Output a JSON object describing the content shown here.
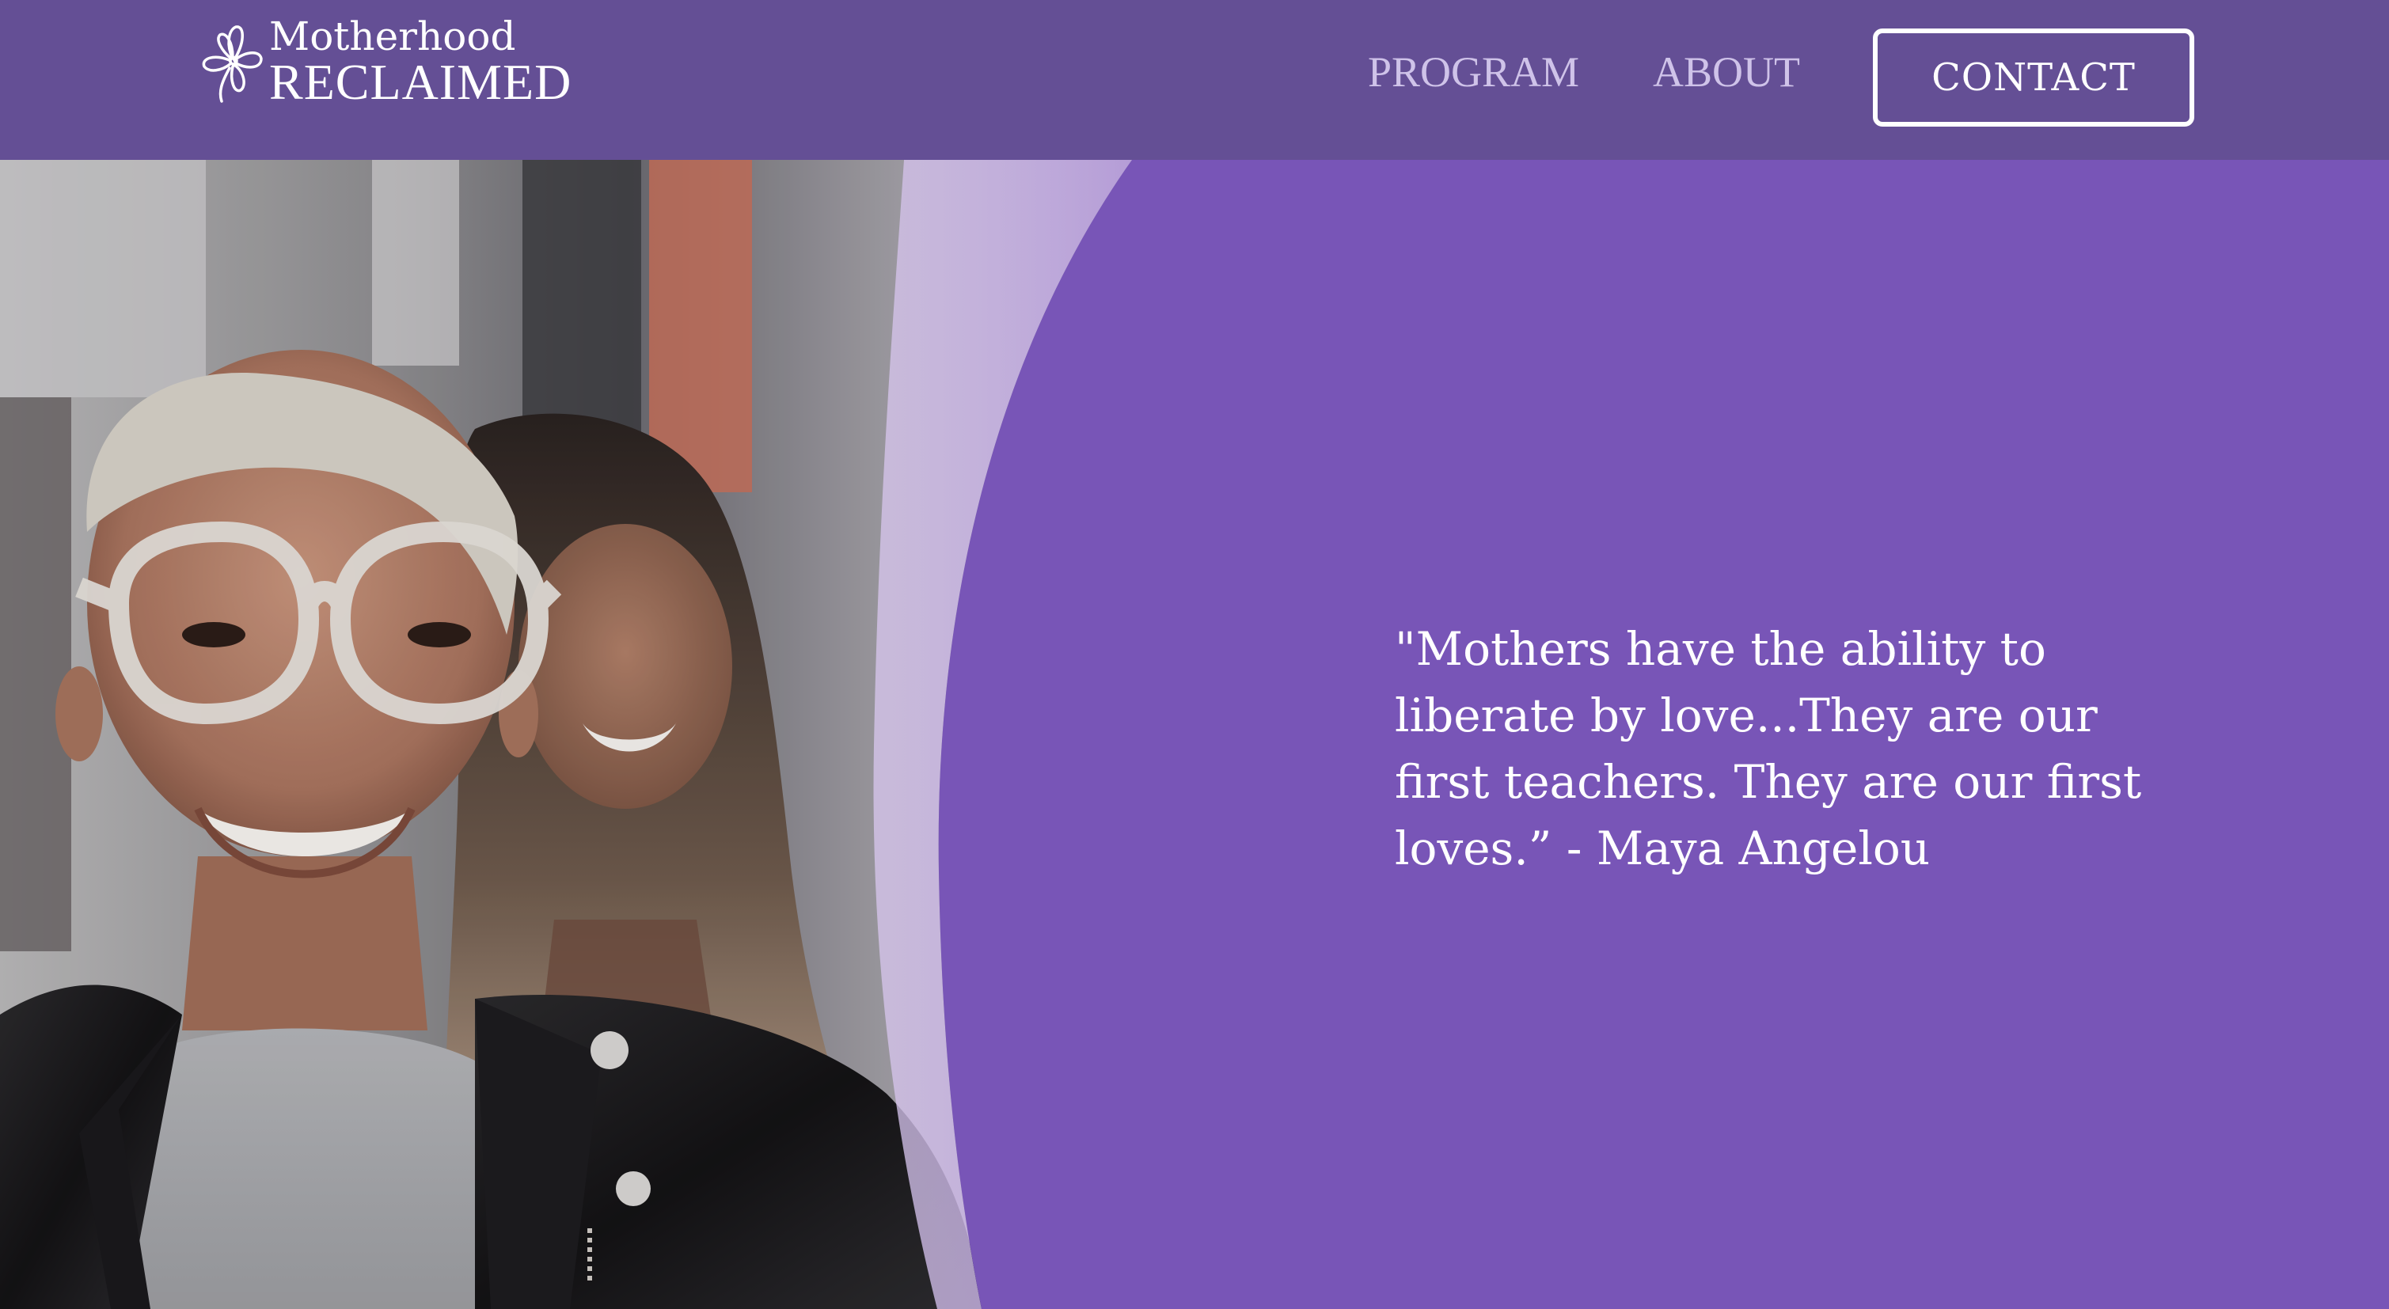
{
  "brand": {
    "name_line1": "Motherhood",
    "name_line2": "RECLAIMED",
    "logo_icon": "flower-icon"
  },
  "nav": {
    "items": [
      {
        "label": "PROGRAM"
      },
      {
        "label": "ABOUT"
      }
    ],
    "contact_label": "CONTACT"
  },
  "hero": {
    "quote": "\"Mothers have the ability to liberate by love...They are our first teachers. They are our first loves.” - Maya Angelou",
    "image": "photo of two smiling women"
  },
  "colors": {
    "header_bg": "#644f95",
    "panel_bg": "#7855b7",
    "nav_text": "#cfc3e9",
    "text": "#ffffff"
  }
}
